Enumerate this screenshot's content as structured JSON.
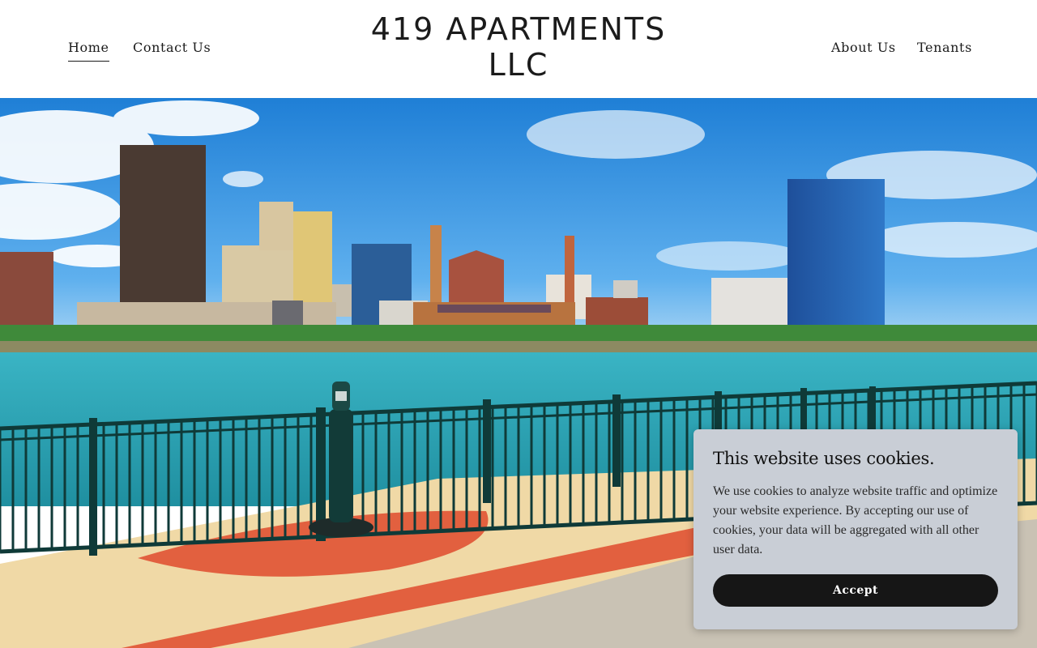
{
  "header": {
    "title_line1": "419 APARTMENTS",
    "title_line2": "LLC",
    "nav_left": [
      {
        "label": "Home",
        "active": true
      },
      {
        "label": "Contact Us",
        "active": false
      }
    ],
    "nav_right": [
      {
        "label": "About Us",
        "active": false
      },
      {
        "label": "Tenants",
        "active": false
      }
    ]
  },
  "hero": {
    "image_subject": "city skyline across a river with a waterfront promenade and railing"
  },
  "cookie_banner": {
    "title": "This website uses cookies.",
    "body": "We use cookies to analyze website traffic and optimize your website experience. By accepting our use of cookies, your data will be aggregated with all other user data.",
    "accept_label": "Accept"
  },
  "colors": {
    "sky": "#2f8fe0",
    "water": "#2aa6b8",
    "promenade": "#f0d9a6",
    "brick_red": "#e2603f",
    "banner_bg": "#c9ced6",
    "button_bg": "#161616"
  }
}
